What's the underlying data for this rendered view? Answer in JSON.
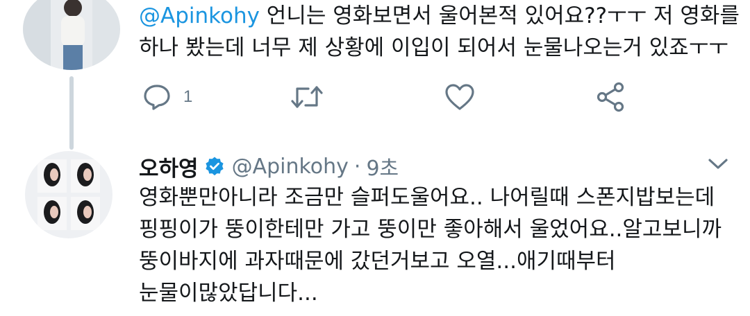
{
  "parent_tweet": {
    "mention": "@Apinkohy",
    "line1_rest": " 언니는 영화보면서 울어본적 있어요??ㅜㅜ 저 영화를",
    "line2": "하나 봤는데 너무 제 상황에 이입이 되어서 눈물나오는거 있죠ㅜㅜ",
    "actions": {
      "reply_icon": "reply-icon",
      "reply_count": "1",
      "retweet_icon": "retweet-icon",
      "like_icon": "heart-icon",
      "share_icon": "share-icon"
    }
  },
  "reply_tweet": {
    "display_name": "오하영",
    "handle": "@Apinkohy",
    "separator": "·",
    "time": "9초",
    "verified_icon": "verified-badge-icon",
    "lines": [
      "영화뿐만아니라 조금만 슬퍼도울어요.. 나어릴때 스폰지밥보는데",
      "핑핑이가 뚱이한테만 가고 뚱이만 좋아해서 울었어요..알고보니까",
      "뚱이바지에 과자때문에 갔던거보고 오열...애기때부터",
      "눈물이많았답니다..."
    ],
    "more_icon": "chevron-down-icon"
  },
  "colors": {
    "accent": "#1b95e0",
    "secondary_text": "#657786",
    "icon_gray": "#657786",
    "thread_line": "#cdd6dd"
  }
}
